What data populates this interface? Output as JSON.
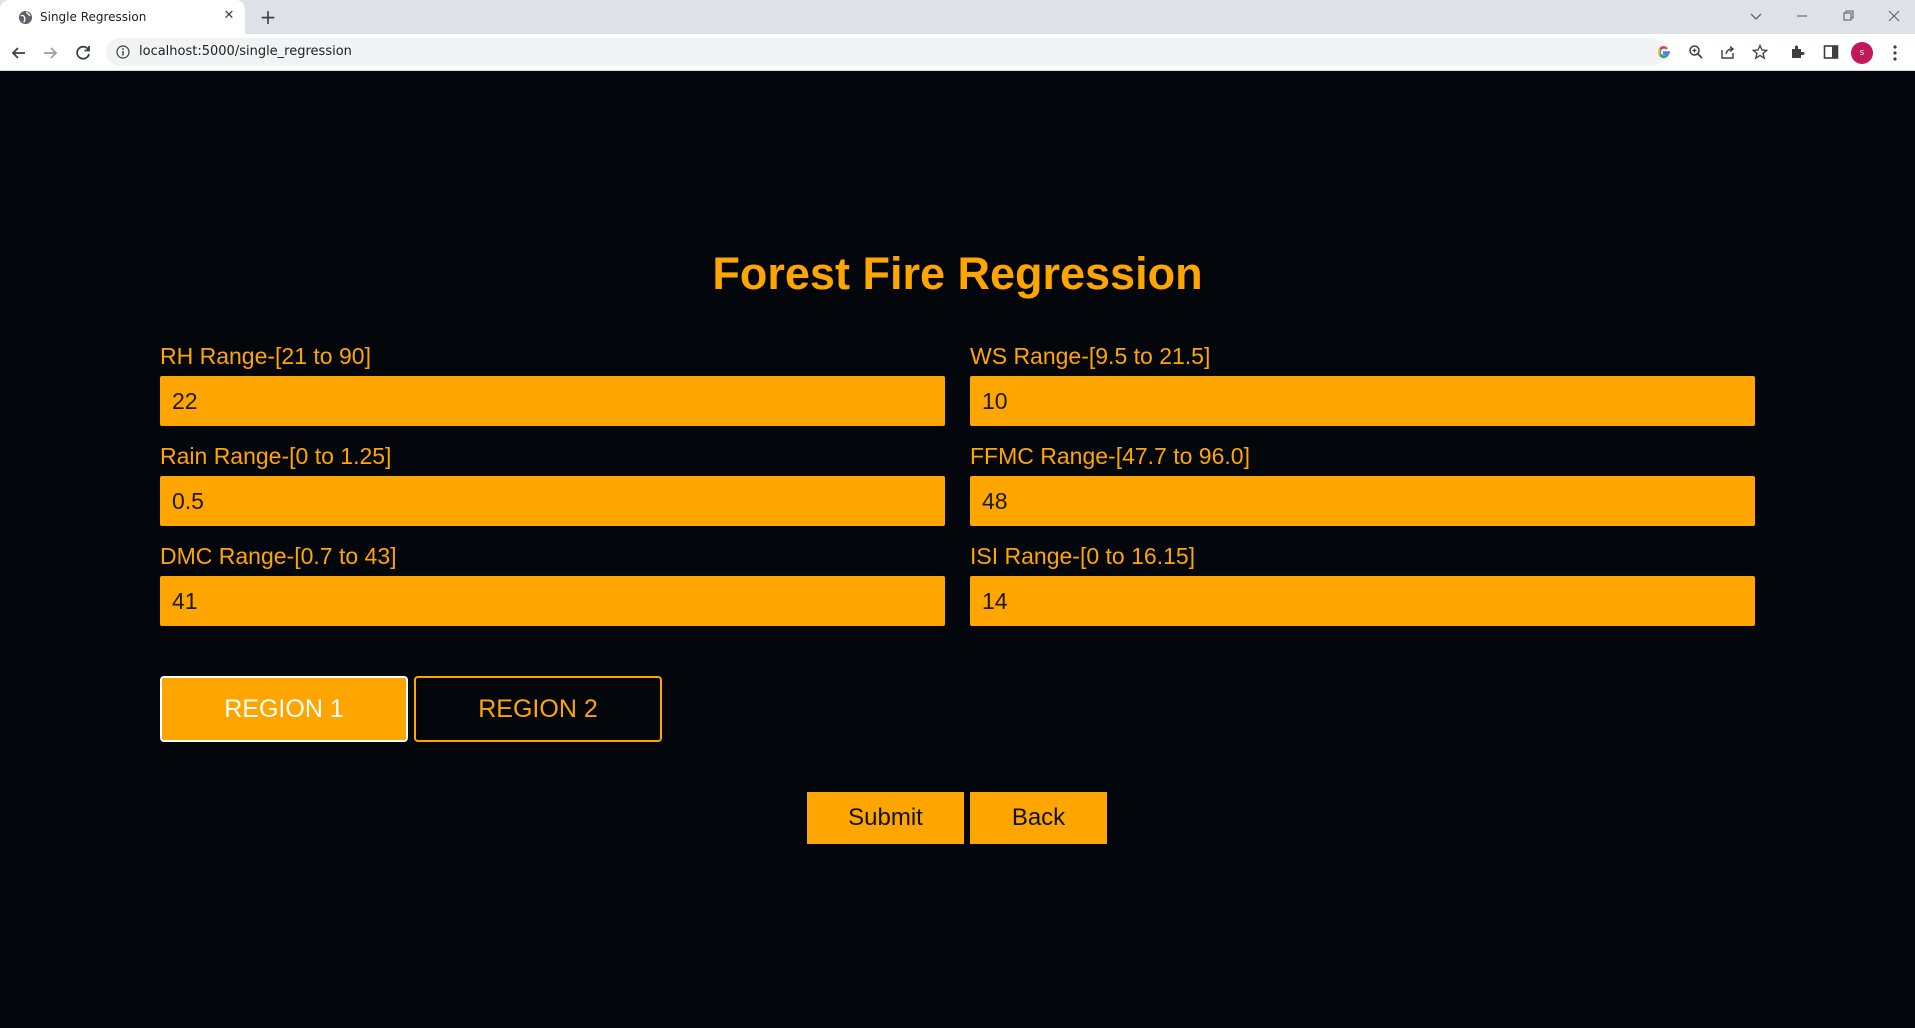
{
  "browser": {
    "tab_title": "Single Regression",
    "tab_close": "✕",
    "new_tab": "+",
    "url": "localhost:5000/single_regression",
    "avatar_letter": "s"
  },
  "page": {
    "title": "Forest Fire Regression"
  },
  "fields": {
    "rh": {
      "label": "RH Range-[21 to 90]",
      "value": "22"
    },
    "ws": {
      "label": "WS Range-[9.5 to 21.5]",
      "value": "10"
    },
    "rain": {
      "label": "Rain Range-[0 to 1.25]",
      "value": "0.5"
    },
    "ffmc": {
      "label": "FFMC Range-[47.7 to 96.0]",
      "value": "48"
    },
    "dmc": {
      "label": "DMC Range-[0.7 to 43]",
      "value": "41"
    },
    "isi": {
      "label": "ISI Range-[0 to 16.15]",
      "value": "14"
    }
  },
  "regions": {
    "region1": "REGION 1",
    "region2": "REGION 2",
    "selected": "REGION 1"
  },
  "actions": {
    "submit": "Submit",
    "back": "Back"
  },
  "colors": {
    "accent": "#ffa500",
    "background": "#03070b"
  }
}
